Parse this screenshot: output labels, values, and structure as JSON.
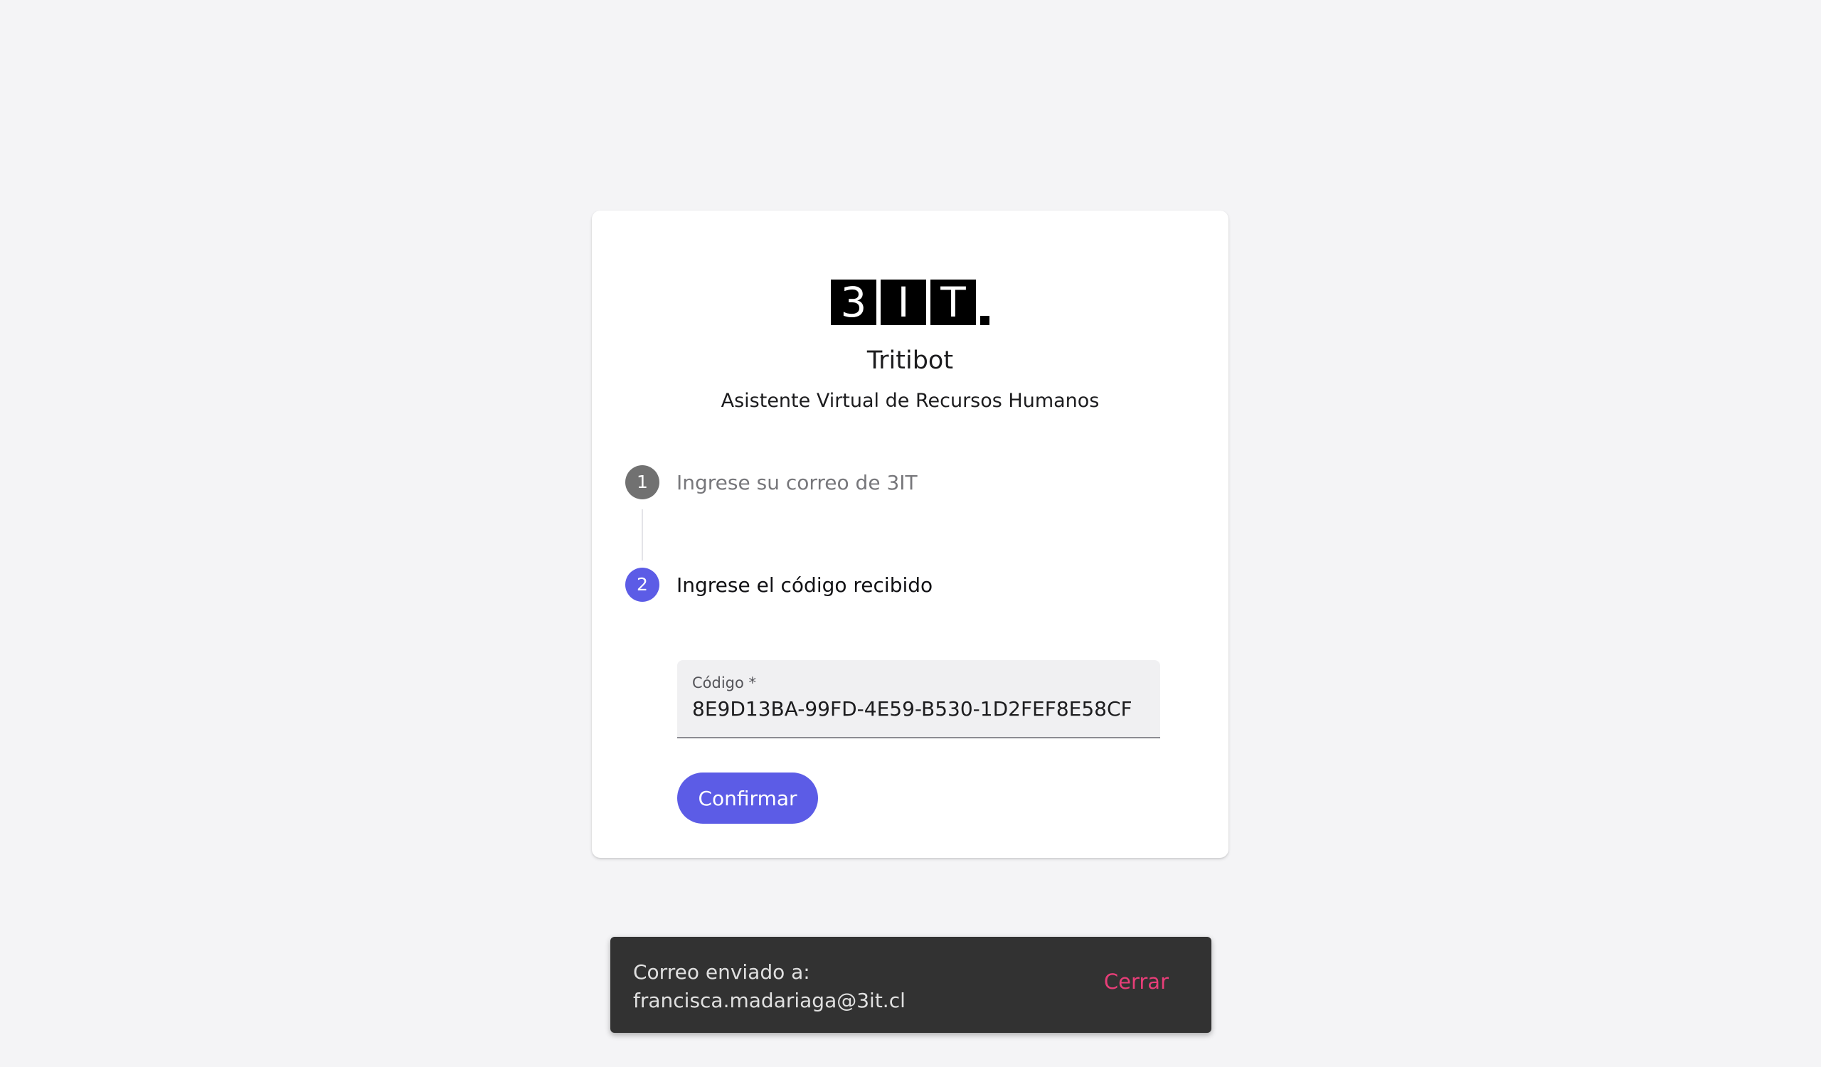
{
  "logo": {
    "letters": [
      "3",
      "I",
      "T"
    ]
  },
  "app": {
    "title": "Tritibot",
    "subtitle": "Asistente Virtual de Recursos Humanos"
  },
  "steps": [
    {
      "number": "1",
      "label": "Ingrese su correo de 3IT",
      "state": "completed"
    },
    {
      "number": "2",
      "label": "Ingrese el código recibido",
      "state": "active"
    }
  ],
  "code_field": {
    "label": "Código *",
    "value": "8E9D13BA-99FD-4E59-B530-1D2FEF8E58CF"
  },
  "confirm_button": {
    "label": "Confirmar"
  },
  "snackbar": {
    "line1": "Correo enviado a:",
    "line2": "francisca.madariaga@3it.cl",
    "action": "Cerrar"
  },
  "colors": {
    "accent": "#5c5ce6",
    "snackbar_action": "#e83e78",
    "background": "#f4f4f6"
  }
}
